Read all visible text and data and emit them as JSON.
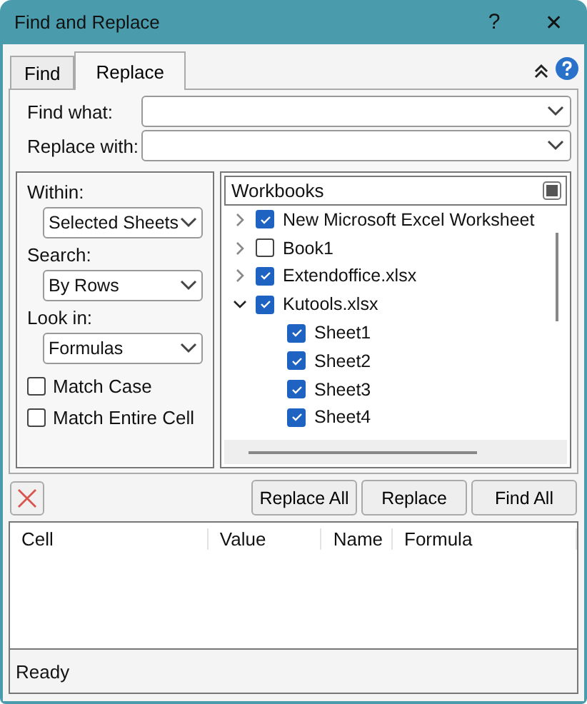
{
  "window": {
    "title": "Find and Replace",
    "help": "?",
    "close": "✕"
  },
  "tabs": [
    {
      "label": "Find",
      "selected": false
    },
    {
      "label": "Replace",
      "selected": true
    }
  ],
  "fields": [
    {
      "label": "Find what:"
    },
    {
      "label": "Replace with:"
    }
  ],
  "options": {
    "dropdowns": [
      {
        "label": "Within:",
        "value": "Selected Sheets"
      },
      {
        "label": "Search:",
        "value": "By Rows"
      },
      {
        "label": "Look in:",
        "value": "Formulas"
      }
    ],
    "checkboxes": [
      {
        "label": "Match Case",
        "checked": false
      },
      {
        "label": "Match Entire Cell",
        "checked": false
      }
    ]
  },
  "tree": {
    "header": "Workbooks",
    "items": [
      {
        "label": "New Microsoft Excel Worksheet",
        "checked": true,
        "expanded": false
      },
      {
        "label": "Book1",
        "checked": false,
        "expanded": false
      },
      {
        "label": "Extendoffice.xlsx",
        "checked": true,
        "expanded": false
      },
      {
        "label": "Kutools.xlsx",
        "checked": true,
        "expanded": true,
        "children": [
          {
            "label": "Sheet1",
            "checked": true
          },
          {
            "label": "Sheet2",
            "checked": true
          },
          {
            "label": "Sheet3",
            "checked": true
          },
          {
            "label": "Sheet4",
            "checked": true
          }
        ]
      }
    ]
  },
  "buttons": [
    "Replace All",
    "Replace",
    "Find All"
  ],
  "results": {
    "columns": [
      "Cell",
      "Value",
      "Name",
      "Formula"
    ]
  },
  "status_bar": "Ready"
}
